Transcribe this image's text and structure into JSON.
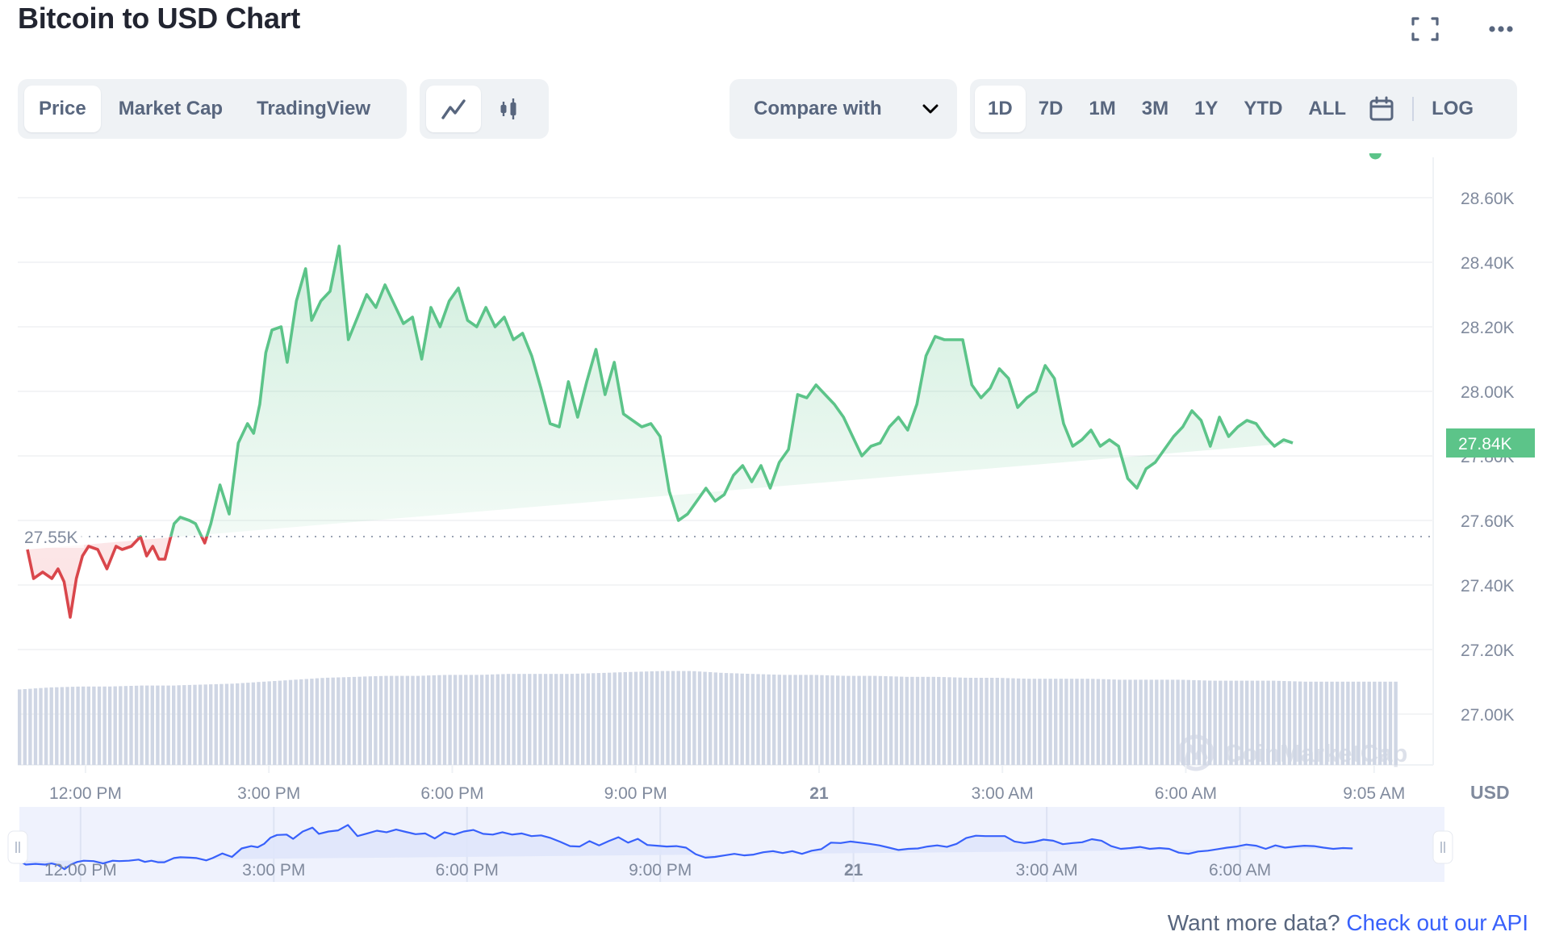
{
  "header": {
    "title": "Bitcoin to USD Chart",
    "fullscreen_icon": "fullscreen-icon",
    "more_icon": "more-horizontal-icon"
  },
  "toolbar": {
    "view_tabs": [
      {
        "label": "Price",
        "active": true
      },
      {
        "label": "Market Cap",
        "active": false
      },
      {
        "label": "TradingView",
        "active": false
      }
    ],
    "chart_types": [
      {
        "icon": "line-chart-icon",
        "active": true
      },
      {
        "icon": "candlestick-icon",
        "active": false
      }
    ],
    "compare": {
      "label": "Compare with",
      "icon": "chevron-down-icon"
    },
    "ranges": [
      {
        "label": "1D",
        "active": true
      },
      {
        "label": "7D",
        "active": false
      },
      {
        "label": "1M",
        "active": false
      },
      {
        "label": "3M",
        "active": false
      },
      {
        "label": "1Y",
        "active": false
      },
      {
        "label": "YTD",
        "active": false
      },
      {
        "label": "ALL",
        "active": false
      }
    ],
    "calendar_icon": "calendar-icon",
    "log_label": "LOG"
  },
  "colors": {
    "up": "#16c784",
    "up_line": "#5cc489",
    "down": "#ea3943",
    "down_line": "#d9464b",
    "volume": "#cfd6e4",
    "navigator_line": "#3861fb",
    "navigator_fill": "#dfe5fb",
    "badge": "#5cc489"
  },
  "chart_data": {
    "type": "line",
    "title": "Bitcoin to USD Chart",
    "currency_label": "USD",
    "baseline": {
      "value": 27550,
      "label": "27.55K"
    },
    "current_price": {
      "value": 27840,
      "label": "27.84K"
    },
    "ylim": [
      26820,
      28700
    ],
    "y_ticks": [
      {
        "value": 28600,
        "label": "28.60K"
      },
      {
        "value": 28400,
        "label": "28.40K"
      },
      {
        "value": 28200,
        "label": "28.20K"
      },
      {
        "value": 28000,
        "label": "28.00K"
      },
      {
        "value": 27800,
        "label": "27.80K"
      },
      {
        "value": 27600,
        "label": "27.60K"
      },
      {
        "value": 27400,
        "label": "27.40K"
      },
      {
        "value": 27200,
        "label": "27.20K"
      },
      {
        "value": 27000,
        "label": "27.00K"
      }
    ],
    "x_unit": "hours since 11:00 AM (day 20)",
    "xlim": [
      -0.15,
      22.85
    ],
    "x_ticks": [
      {
        "value": 1,
        "label": "12:00 PM",
        "bold": false
      },
      {
        "value": 4,
        "label": "3:00 PM",
        "bold": false
      },
      {
        "value": 7,
        "label": "6:00 PM",
        "bold": false
      },
      {
        "value": 10,
        "label": "9:00 PM",
        "bold": false
      },
      {
        "value": 13,
        "label": "21",
        "bold": true
      },
      {
        "value": 16,
        "label": "3:00 AM",
        "bold": false
      },
      {
        "value": 19,
        "label": "6:00 AM",
        "bold": false
      },
      {
        "value": 22.08,
        "label": "9:05 AM",
        "bold": false
      }
    ],
    "series": [
      {
        "name": "Price",
        "x": [
          0.05,
          0.15,
          0.3,
          0.45,
          0.55,
          0.65,
          0.75,
          0.85,
          0.95,
          1.05,
          1.2,
          1.35,
          1.5,
          1.6,
          1.75,
          1.9,
          2.0,
          2.1,
          2.2,
          2.3,
          2.45,
          2.55,
          2.7,
          2.8,
          2.95,
          3.05,
          3.2,
          3.35,
          3.5,
          3.65,
          3.75,
          3.85,
          3.95,
          4.05,
          4.2,
          4.3,
          4.45,
          4.6,
          4.7,
          4.85,
          5.0,
          5.15,
          5.3,
          5.45,
          5.6,
          5.75,
          5.9,
          6.05,
          6.2,
          6.35,
          6.5,
          6.65,
          6.8,
          6.95,
          7.1,
          7.25,
          7.4,
          7.55,
          7.7,
          7.85,
          8.0,
          8.15,
          8.3,
          8.45,
          8.6,
          8.75,
          8.9,
          9.05,
          9.2,
          9.35,
          9.5,
          9.65,
          9.8,
          9.95,
          10.1,
          10.25,
          10.4,
          10.55,
          10.7,
          10.85,
          11.0,
          11.15,
          11.3,
          11.45,
          11.6,
          11.75,
          11.9,
          12.05,
          12.2,
          12.35,
          12.5,
          12.65,
          12.8,
          12.95,
          13.1,
          13.25,
          13.4,
          13.55,
          13.7,
          13.85,
          14.0,
          14.15,
          14.3,
          14.45,
          14.6,
          14.75,
          14.9,
          15.05,
          15.2,
          15.35,
          15.5,
          15.65,
          15.8,
          15.95,
          16.1,
          16.25,
          16.4,
          16.55,
          16.7,
          16.85,
          17.0,
          17.15,
          17.3,
          17.45,
          17.6,
          17.75,
          17.9,
          18.05,
          18.2,
          18.35,
          18.5,
          18.65,
          18.8,
          18.95,
          19.1,
          19.25,
          19.4,
          19.55,
          19.7,
          19.85,
          20.0,
          20.15,
          20.3,
          20.45,
          20.6,
          20.75,
          20.9,
          21.05,
          21.2,
          21.35,
          21.5,
          21.65,
          21.8,
          21.95,
          22.1
        ],
        "y": [
          27510,
          27420,
          27440,
          27420,
          27450,
          27410,
          27300,
          27420,
          27490,
          27520,
          27510,
          27450,
          27520,
          27510,
          27520,
          27550,
          27490,
          27520,
          27480,
          27480,
          27590,
          27610,
          27600,
          27590,
          27530,
          27590,
          27710,
          27620,
          27840,
          27900,
          27870,
          27960,
          28120,
          28190,
          28200,
          28090,
          28280,
          28380,
          28220,
          28280,
          28310,
          28450,
          28160,
          28230,
          28300,
          28260,
          28330,
          28270,
          28210,
          28230,
          28100,
          28260,
          28200,
          28280,
          28320,
          28220,
          28200,
          28260,
          28200,
          28230,
          28160,
          28180,
          28110,
          28010,
          27900,
          27890,
          28030,
          27920,
          28030,
          28130,
          27990,
          28090,
          27930,
          27910,
          27890,
          27900,
          27860,
          27690,
          27600,
          27620,
          27660,
          27700,
          27660,
          27680,
          27740,
          27770,
          27720,
          27770,
          27700,
          27780,
          27820,
          27990,
          27980,
          28020,
          27990,
          27960,
          27920,
          27860,
          27800,
          27830,
          27840,
          27890,
          27920,
          27880,
          27960,
          28110,
          28170,
          28160,
          28160,
          28160,
          28020,
          27980,
          28010,
          28070,
          28040,
          27950,
          27980,
          28000,
          28080,
          28040,
          27900,
          27830,
          27850,
          27880,
          27830,
          27850,
          27830,
          27730,
          27700,
          27760,
          27780,
          27820,
          27860,
          27890,
          27940,
          27910,
          27830,
          27920,
          27860,
          27890,
          27910,
          27900,
          27860,
          27830,
          27850,
          27840
        ],
        "color_above_baseline": "#5cc489",
        "color_below_baseline": "#d9464b"
      }
    ],
    "volume_relative": [
      0.78,
      0.8,
      0.81,
      0.81,
      0.82,
      0.82,
      0.83,
      0.84,
      0.86,
      0.88,
      0.9,
      0.91,
      0.92,
      0.92,
      0.93,
      0.93,
      0.94,
      0.94,
      0.94,
      0.95,
      0.96,
      0.97,
      0.97,
      0.95,
      0.94,
      0.93,
      0.93,
      0.92,
      0.92,
      0.91,
      0.91,
      0.9,
      0.9,
      0.89,
      0.89,
      0.89,
      0.88,
      0.88,
      0.88,
      0.87,
      0.87,
      0.87,
      0.86,
      0.86,
      0.86,
      0.86
    ],
    "watermark": "CoinMarketCap",
    "navigator": {
      "x_ticks": [
        {
          "value": 1,
          "label": "12:00 PM",
          "bold": false
        },
        {
          "value": 4,
          "label": "3:00 PM",
          "bold": false
        },
        {
          "value": 7,
          "label": "6:00 PM",
          "bold": false
        },
        {
          "value": 10,
          "label": "9:00 PM",
          "bold": false
        },
        {
          "value": 13,
          "label": "21",
          "bold": true
        },
        {
          "value": 16,
          "label": "3:00 AM",
          "bold": false
        },
        {
          "value": 19,
          "label": "6:00 AM",
          "bold": false
        }
      ],
      "selected_range": [
        0,
        1
      ]
    }
  },
  "footer": {
    "prompt": "Want more data? ",
    "link_label": "Check out our API"
  }
}
